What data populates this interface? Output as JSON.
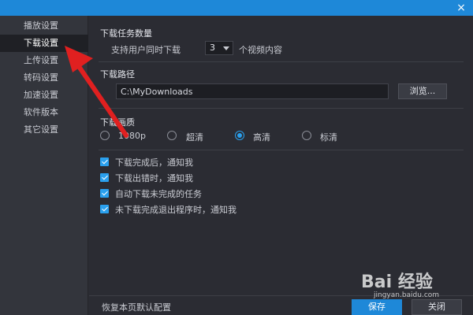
{
  "window": {
    "close_glyph": "×"
  },
  "sidebar": {
    "items": [
      {
        "label": "播放设置",
        "active": false
      },
      {
        "label": "下载设置",
        "active": true
      },
      {
        "label": "上传设置",
        "active": false
      },
      {
        "label": "转码设置",
        "active": false
      },
      {
        "label": "加速设置",
        "active": false
      },
      {
        "label": "软件版本",
        "active": false
      },
      {
        "label": "其它设置",
        "active": false
      }
    ]
  },
  "download_tasks": {
    "title": "下载任务数量",
    "prefix": "支持用户同时下载",
    "count": "3",
    "suffix": "个视频内容"
  },
  "download_path": {
    "title": "下载路径",
    "value": "C:\\MyDownloads",
    "browse_label": "浏览..."
  },
  "quality": {
    "title": "下载画质",
    "options": [
      {
        "label": "1080p",
        "selected": false
      },
      {
        "label": "超清",
        "selected": false
      },
      {
        "label": "高清",
        "selected": true
      },
      {
        "label": "标清",
        "selected": false
      }
    ]
  },
  "notifications": {
    "options": [
      {
        "label": "下载完成后，通知我",
        "checked": true
      },
      {
        "label": "下载出错时，通知我",
        "checked": true
      },
      {
        "label": "自动下载未完成的任务",
        "checked": true
      },
      {
        "label": "未下载完成退出程序时，通知我",
        "checked": true
      }
    ]
  },
  "footer": {
    "reset_label": "恢复本页默认配置",
    "save_label": "保存",
    "close_label": "关闭"
  },
  "watermark": {
    "logo_text": "Bai 经验",
    "site": "jingyan.baidu.com"
  },
  "colors": {
    "accent": "#1e88d8",
    "arrow": "#e02020"
  }
}
